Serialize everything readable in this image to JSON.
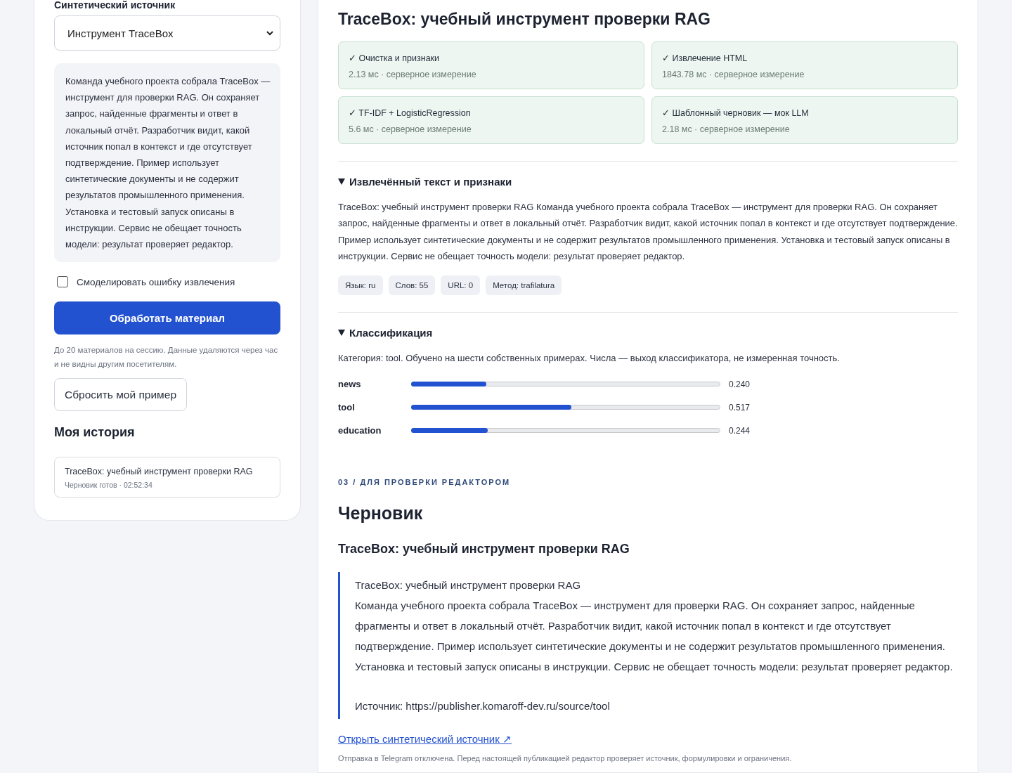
{
  "sidebar": {
    "source_label": "Синтетический источник",
    "source_select": {
      "value": "Инструмент TraceBox"
    },
    "description": "Команда учебного проекта собрала TraceBox — инструмент для проверки RAG. Он сохраняет запрос, найденные фрагменты и ответ в локальный отчёт. Разработчик видит, какой источник попал в контекст и где отсутствует подтверждение. Пример использует синтетические документы и не содержит результатов промышленного применения. Установка и тестовый запуск описаны в инструкции. Сервис не обещает точность модели: результат проверяет редактор.",
    "simulate_error": {
      "label": "Смоделировать ошибку извлечения",
      "checked": false
    },
    "process_button": "Обработать материал",
    "note": "До 20 материалов на сессию. Данные удаляются через час и не видны другим посетителям.",
    "reset_button": "Сбросить мой пример",
    "history_title": "Моя история",
    "history": [
      {
        "title": "TraceBox: учебный инструмент проверки RAG",
        "meta": "Черновик готов · 02:52:34"
      }
    ]
  },
  "main": {
    "title": "TraceBox: учебный инструмент проверки RAG",
    "steps": [
      {
        "label": "✓ Очистка и признаки",
        "meta": "2.13 мс · серверное измерение"
      },
      {
        "label": "✓ Извлечение HTML",
        "meta": "1843.78 мс · серверное измерение"
      },
      {
        "label": "✓ TF-IDF + LogisticRegression",
        "meta": "5.6 мс · серверное измерение"
      },
      {
        "label": "✓ Шаблонный черновик — мок LLM",
        "meta": "2.18 мс · серверное измерение"
      }
    ],
    "extracted": {
      "title": "Извлечённый текст и признаки",
      "expanded": true,
      "text": "TraceBox: учебный инструмент проверки RAG Команда учебного проекта собрала TraceBox — инструмент для проверки RAG. Он сохраняет запрос, найденные фрагменты и ответ в локальный отчёт. Разработчик видит, какой источник попал в контекст и где отсутствует подтверждение. Пример использует синтетические документы и не содержит результатов промышленного применения. Установка и тестовый запуск описаны в инструкции. Сервис не обещает точность модели: результат проверяет редактор.",
      "tags": [
        "Язык: ru",
        "Слов: 55",
        "URL: 0",
        "Метод: trafilatura"
      ]
    },
    "classification": {
      "title": "Классификация",
      "expanded": true,
      "summary": "Категория: tool. Обучено на шести собственных примерах. Числа — выход классификатора, не измеренная точность.",
      "scores": [
        {
          "label": "news",
          "level": 0.24,
          "value": "0.240"
        },
        {
          "label": "tool",
          "level": 0.517,
          "value": "0.517"
        },
        {
          "label": "education",
          "level": 0.244,
          "value": "0.244"
        }
      ]
    },
    "section_kicker": "03 / ДЛЯ ПРОВЕРКИ РЕДАКТОРОМ",
    "draft": {
      "title": "Черновик",
      "subtitle": "TraceBox: учебный инструмент проверки RAG",
      "quote_title": "TraceBox: учебный инструмент проверки RAG",
      "quote_body": "Команда учебного проекта собрала TraceBox — инструмент для проверки RAG. Он сохраняет запрос, найденные фрагменты и ответ в локальный отчёт. Разработчик видит, какой источник попал в контекст и где отсутствует подтверждение. Пример использует синтетические документы и не содержит результатов промышленного применения. Установка и тестовый запуск описаны в инструкции. Сервис не обещает точность модели: результат проверяет редактор.",
      "source": "Источник: https://publisher.komaroff-dev.ru/source/tool"
    },
    "link": "Открыть синтетический источник ↗",
    "footer_note": "Отправка в Telegram отключена. Перед настоящей публикацией редактор проверяет источник, формулировки и ограничения."
  }
}
